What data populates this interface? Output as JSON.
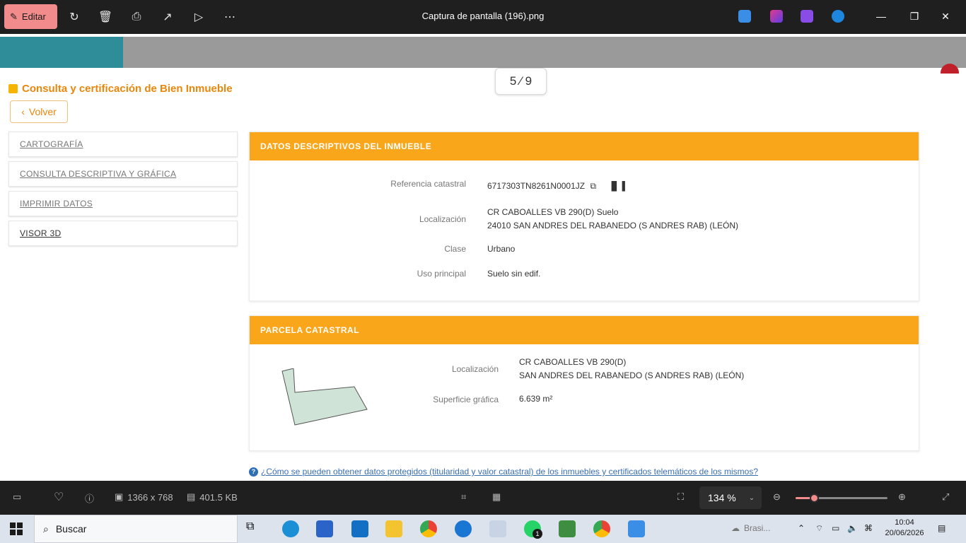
{
  "viewer": {
    "edit_label": "Editar",
    "file_title": "Captura de pantalla (196).png",
    "page_counter": "5 ⁄ 9",
    "dimensions": "1366 x 768",
    "file_size": "401.5 KB",
    "zoom": "134 %",
    "zoom_fraction": 0.2
  },
  "page": {
    "title": "Consulta y certificación de Bien Inmueble",
    "back_label": "Volver",
    "sidebar": [
      {
        "label": "CARTOGRAFÍA"
      },
      {
        "label": "CONSULTA DESCRIPTIVA Y GRÁFICA"
      },
      {
        "label": "IMPRIMIR DATOS"
      },
      {
        "label": "VISOR 3D"
      }
    ],
    "descriptive": {
      "header": "DATOS DESCRIPTIVOS DEL INMUEBLE",
      "ref_label": "Referencia catastral",
      "ref_value": "6717303TN8261N0001JZ",
      "loc_label": "Localización",
      "loc_line1": "CR CABOALLES VB 290(D) Suelo",
      "loc_line2": "24010 SAN ANDRES DEL RABANEDO (S ANDRES RAB) (LEÓN)",
      "class_label": "Clase",
      "class_value": "Urbano",
      "use_label": "Uso principal",
      "use_value": "Suelo sin edif."
    },
    "parcel": {
      "header": "PARCELA CATASTRAL",
      "loc_label": "Localización",
      "loc_line1": "CR CABOALLES VB 290(D)",
      "loc_line2": "SAN ANDRES DEL RABANEDO (S ANDRES RAB) (LEÓN)",
      "surface_label": "Superficie gráfica",
      "surface_value": "6.639 m²"
    },
    "help_text": "¿Cómo se pueden obtener datos protegidos (titularidad y valor catastral) de los inmuebles y certificados telemáticos de los mismos?"
  },
  "taskbar": {
    "search_placeholder": "Buscar",
    "weather": "Brasi...",
    "time": "10:04",
    "date": "20/06/2026",
    "whatsapp_badge": "1"
  },
  "colors": {
    "accent_orange": "#faa61a",
    "title_orange": "#e8870c",
    "edit_pink": "#f28b8b",
    "parcel_fill": "#cfe3d6"
  }
}
